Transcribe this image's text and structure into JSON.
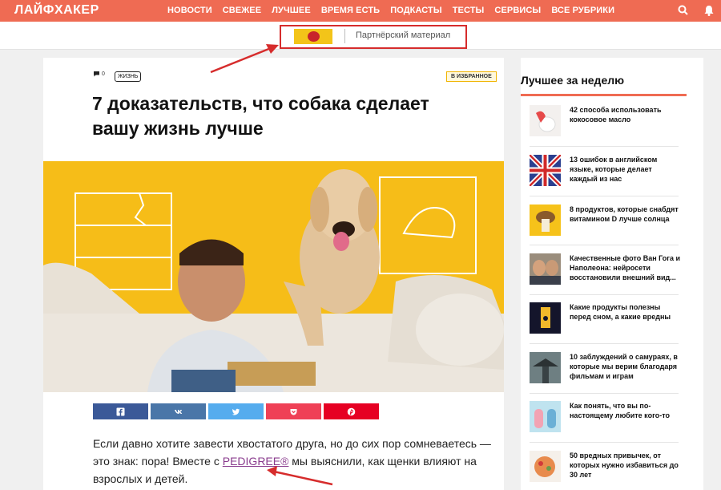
{
  "header": {
    "logo": "ЛАЙФХАКЕР",
    "nav": [
      "НОВОСТИ",
      "СВЕЖЕЕ",
      "ЛУЧШЕЕ",
      "ВРЕМЯ ЕСТЬ",
      "ПОДКАСТЫ",
      "ТЕСТЫ",
      "СЕРВИСЫ",
      "ВСЕ РУБРИКИ"
    ],
    "icons": [
      "search-icon",
      "bell-icon"
    ],
    "accent_color": "#ef6b53"
  },
  "partner": {
    "label": "Партнёрский материал",
    "logo_icon": "pedigree-logo"
  },
  "article": {
    "comment_count": "0",
    "tag": "ЖИЗНЬ",
    "favorite_label": "В ИЗБРАННОЕ",
    "title": "7 доказательств, что собака сделает вашу жизнь лучше",
    "share_buttons": [
      {
        "icon": "facebook-icon",
        "color": "#3b5998"
      },
      {
        "icon": "vk-icon",
        "color": "#4a76a8"
      },
      {
        "icon": "twitter-icon",
        "color": "#55acee"
      },
      {
        "icon": "pocket-icon",
        "color": "#ef4056"
      },
      {
        "icon": "pinterest-icon",
        "color": "#e60023"
      }
    ],
    "body_before": "Если давно хотите завести хвостатого друга, но до сих пор сомневаетесь — это знак: пора! Вместе с ",
    "body_link": "PEDIGREE®",
    "body_after": " мы выяснили, как щенки влияют на взрослых и детей."
  },
  "sidebar": {
    "title": "Лучшее за неделю",
    "items": [
      {
        "text": "42 способа использовать кокосовое масло"
      },
      {
        "text": "13 ошибок в английском языке, которые делает каждый из нас"
      },
      {
        "text": "8 продуктов, которые снабдят витамином D лучше солнца"
      },
      {
        "text": "Качественные фото Ван Гога и Наполеона: нейросети восстановили внешний вид..."
      },
      {
        "text": "Какие продукты полезны перед сном, а какие вредны"
      },
      {
        "text": "10 заблуждений о самураях, в которые мы верим благодаря фильмам и играм"
      },
      {
        "text": "Как понять, что вы по-настоящему любите кого-то"
      },
      {
        "text": "50 вредных привычек, от которых нужно избавиться до 30 лет"
      }
    ]
  }
}
